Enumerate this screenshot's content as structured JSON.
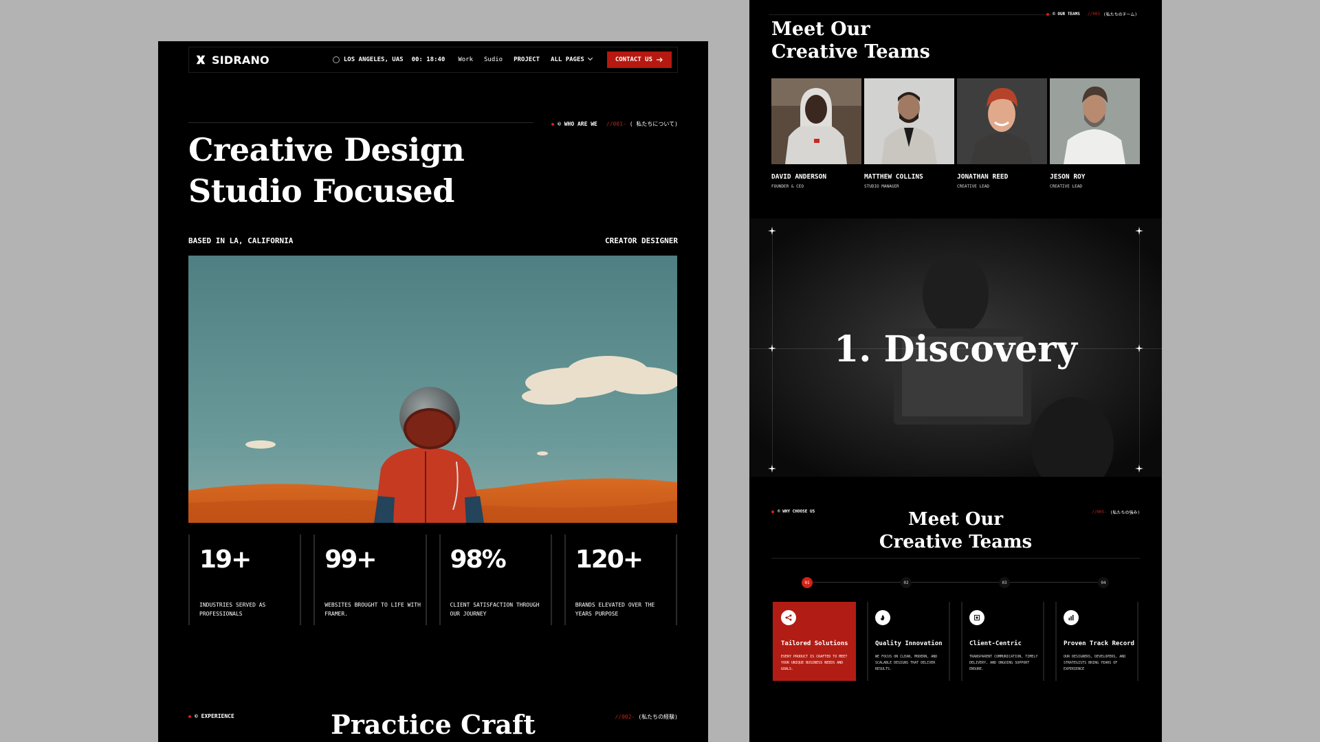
{
  "nav": {
    "brand": "SIDRANO",
    "location": "LOS ANGELES, UAS",
    "time": "00: 18:40",
    "links": [
      "Work",
      "Sudio",
      "PROJECT",
      "ALL PAGES"
    ],
    "contact_label": "CONTACT US"
  },
  "about": {
    "tag": "© WHO ARE WE",
    "tag_num": "//001-",
    "tag_jp": "( 私たちについて)",
    "title_line1": "Creative Design",
    "title_line2": "Studio Focused",
    "based": "BASED IN LA, CALIFORNIA",
    "role": "CREATOR DESIGNER"
  },
  "stats": [
    {
      "value": "19+",
      "label": "INDUSTRIES SERVED AS PROFESSIONALS"
    },
    {
      "value": "99+",
      "label": "WEBSITES BROUGHT TO LIFE WITH FRAMER."
    },
    {
      "value": "98%",
      "label": "CLIENT SATISFACTION THROUGH OUR JOURNEY"
    },
    {
      "value": "120+",
      "label": "BRANDS ELEVATED OVER THE YEARS PURPOSE"
    }
  ],
  "experience": {
    "tag": "© EXPERIENCE",
    "tag_num": "//002-",
    "tag_jp": "(私たちの経験)",
    "title": "Practice Craft"
  },
  "teams": {
    "tag": "© OUR TEAMS",
    "tag_num": "//003",
    "tag_jp": "(私たちのチーム)",
    "title_line1": "Meet Our",
    "title_line2": "Creative Teams",
    "members": [
      {
        "name": "DAVID ANDERSON",
        "role": "FOUNDER & CEO"
      },
      {
        "name": "MATTHEW COLLINS",
        "role": "STUDIO MANAGER"
      },
      {
        "name": "JONATHAN REED",
        "role": "CREATIVE LEAD"
      },
      {
        "name": "JESON ROY",
        "role": "CREATIVE LEAD"
      }
    ]
  },
  "process": {
    "title": "1. Discovery"
  },
  "why": {
    "tag": "© WHY CHOOSE US",
    "tag_num": "//005-",
    "tag_jp": "(私たちの強み)",
    "title_line1": "Meet Our",
    "title_line2": "Creative Teams",
    "steps": [
      "01",
      "02",
      "03",
      "04"
    ],
    "cards": [
      {
        "title": "Tailored Solutions",
        "desc": "EVERY PRODUCT IS CRAFTED TO MEET YOUR UNIQUE BUSINESS NEEDS AND GOALS."
      },
      {
        "title": "Quality Innovation",
        "desc": "WE FOCUS ON CLEAN, MODERN, AND SCALABLE DESIGNS THAT DELIVER RESULTS."
      },
      {
        "title": "Client-Centric",
        "desc": "TRANSPARENT COMMUNICATION, TIMELY DELIVERY, AND ONGOING SUPPORT ENSURE."
      },
      {
        "title": "Proven Track Record",
        "desc": "OUR DESIGNERS, DEVELOPERS, AND STRATEGISTS BRING YEARS OF EXPERIENCE"
      }
    ]
  },
  "colors": {
    "accent": "#b51910",
    "background": "#000000",
    "canvas": "#b3b3b3"
  }
}
